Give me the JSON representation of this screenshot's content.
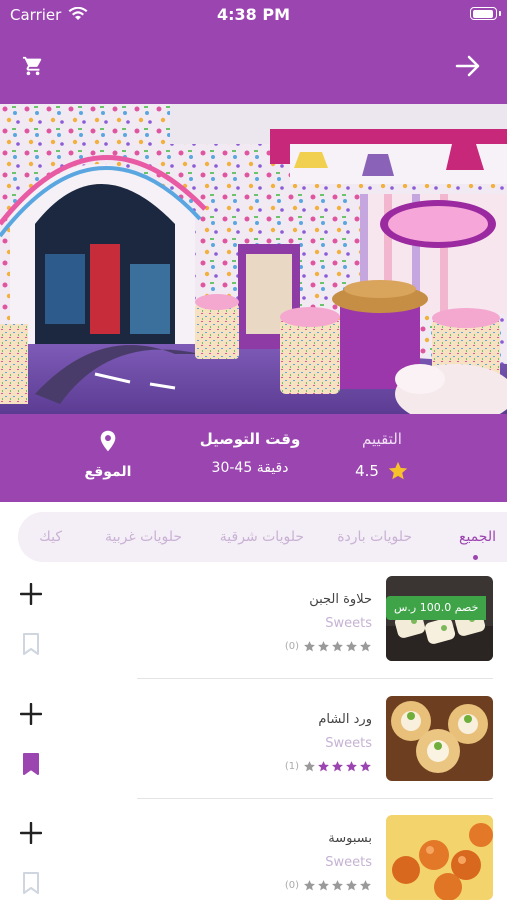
{
  "status_bar": {
    "carrier": "Carrier",
    "time": "4:38 PM"
  },
  "header": {
    "cart_icon": "cart-icon",
    "forward_icon": "arrow-right-icon"
  },
  "colors": {
    "primary": "#9b45b0",
    "discount": "#3fa448",
    "star": "#f6c12b"
  },
  "store_info": {
    "rating_label": "التقييم",
    "rating_value": "4.5",
    "delivery_label": "وقت التوصيل",
    "delivery_value": "30-45 دقيقة",
    "location_label": "الموقع"
  },
  "tabs": [
    {
      "label": "الجميع",
      "active": true
    },
    {
      "label": "حلويات باردة",
      "active": false
    },
    {
      "label": "حلويات شرقية",
      "active": false
    },
    {
      "label": "حلويات غربية",
      "active": false
    },
    {
      "label": "كيك",
      "active": false
    }
  ],
  "items": [
    {
      "name": "حلاوة الجبن",
      "category": "Sweets",
      "rating_count": "(0)",
      "stars": 0,
      "bookmarked": false,
      "discount": "خصم 100.0 ر.س"
    },
    {
      "name": "ورد الشام",
      "category": "Sweets",
      "rating_count": "(1)",
      "stars": 4,
      "bookmarked": true
    },
    {
      "name": "بسبوسة",
      "category": "Sweets",
      "rating_count": "(0)",
      "stars": 0,
      "bookmarked": false
    }
  ]
}
